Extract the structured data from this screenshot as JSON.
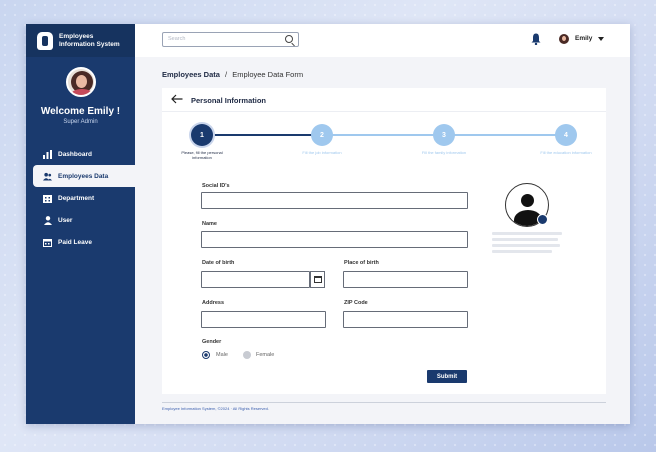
{
  "brand": {
    "line1": "Employees",
    "line2": "Information System"
  },
  "user": {
    "welcome": "Welcome Emily !",
    "role": "Super Admin",
    "name": "Emily"
  },
  "sidebar": {
    "items": [
      {
        "label": "Dashboard",
        "icon": "bar-chart-icon"
      },
      {
        "label": "Employees Data",
        "icon": "users-icon",
        "active": true
      },
      {
        "label": "Department",
        "icon": "building-icon"
      },
      {
        "label": "User",
        "icon": "user-icon"
      },
      {
        "label": "Paid Leave",
        "icon": "calendar-icon"
      }
    ]
  },
  "topbar": {
    "search_placeholder": "Search"
  },
  "breadcrumb": {
    "main": "Employees Data",
    "sep": "/",
    "current": "Employee Data Form"
  },
  "card": {
    "title": "Personal Information"
  },
  "stepper": {
    "steps": [
      {
        "number": "1",
        "caption": "Please, fill the personal information"
      },
      {
        "number": "2",
        "caption": "Fill the job information"
      },
      {
        "number": "3",
        "caption": "Fill the family information"
      },
      {
        "number": "4",
        "caption": "Fill the education information"
      }
    ]
  },
  "form": {
    "social_id_label": "Social ID's",
    "name_label": "Name",
    "dob_label": "Date of birth",
    "pob_label": "Place of birth",
    "address_label": "Address",
    "zip_label": "ZIP Code",
    "gender_label": "Gender",
    "gender_options": [
      "Male",
      "Female"
    ],
    "gender_selected": "Male",
    "submit_label": "Submit"
  },
  "footer": {
    "text": "Employee Information System, ©2024 · All Rights Reserved."
  },
  "colors": {
    "primary": "#1a3a6e",
    "step_inactive": "#9fc8ee",
    "page_bg": "#f3f4f8"
  }
}
